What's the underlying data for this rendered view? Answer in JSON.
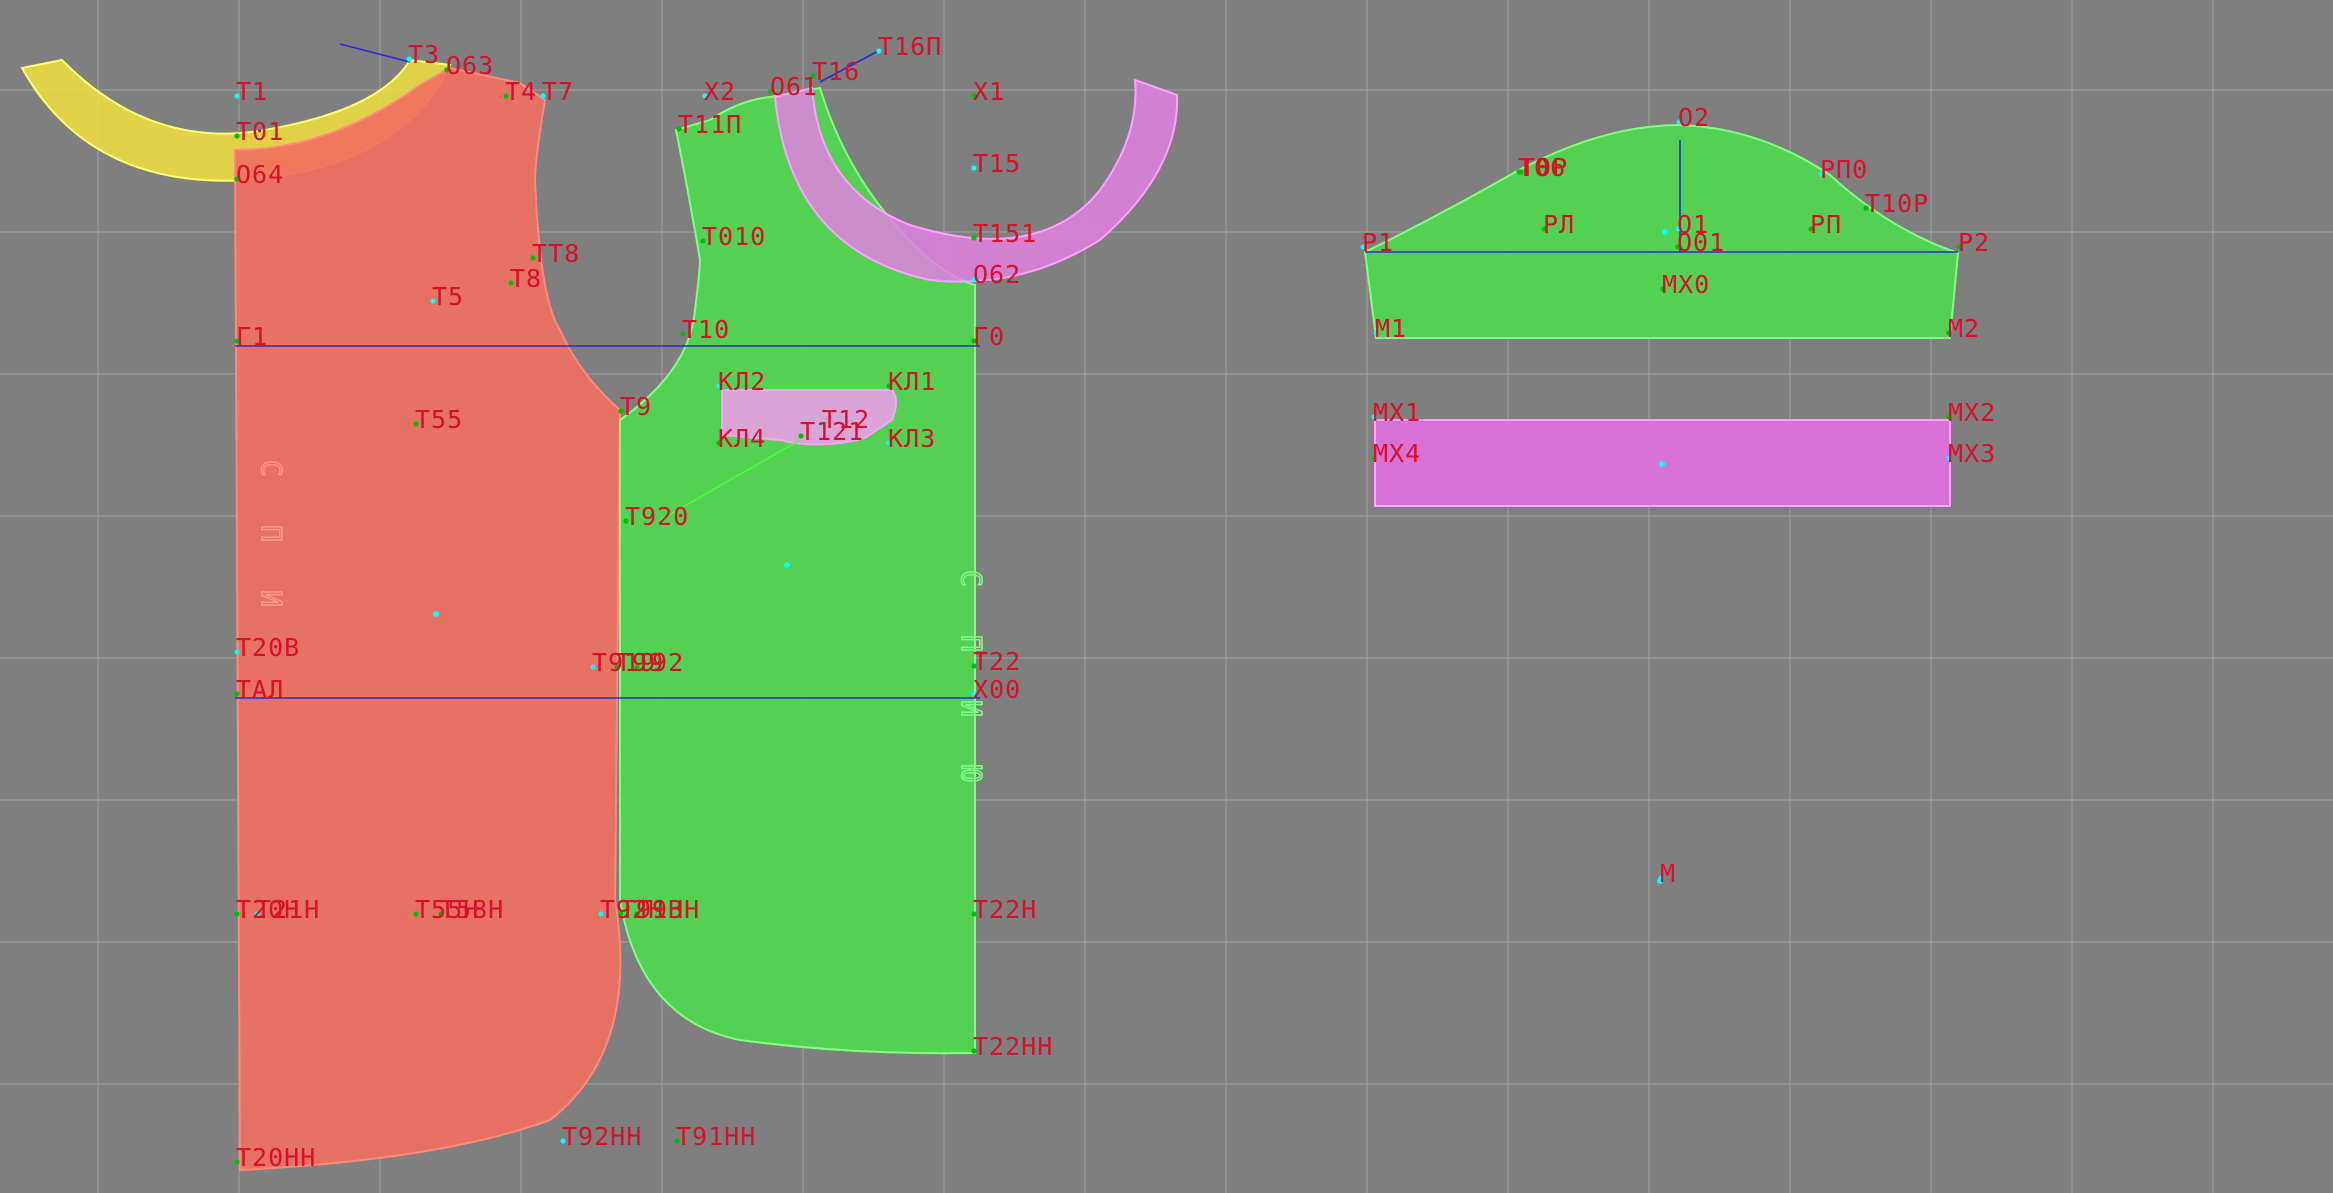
{
  "colors": {
    "background": "#7f7f7f",
    "grid": "#9a9a9a",
    "label": "#d8102a",
    "back_fill": "#f07060",
    "back_stroke": "#ff8a7a",
    "front_fill": "#4fd84f",
    "front_stroke": "#7fff7f",
    "facing_fill": "#f0e040",
    "facing_stroke": "#ffff70",
    "neck_facing_fill": "#e080e0",
    "neck_facing_stroke": "#ff9fff",
    "pocket_fill": "#e8a0e8",
    "sleeve_fill": "#4fd84f",
    "strip_fill": "#e070e0",
    "construction_line": "#2a2ad8",
    "point": "#00c000",
    "point_alt": "#00ffff"
  },
  "pieces": [
    {
      "id": "back",
      "name": "back-piece"
    },
    {
      "id": "front",
      "name": "front-piece"
    },
    {
      "id": "back_neck_facing",
      "name": "back-neck-facing"
    },
    {
      "id": "front_neck_facing",
      "name": "front-neck-facing"
    },
    {
      "id": "pocket",
      "name": "pocket-piece"
    },
    {
      "id": "sleeve",
      "name": "sleeve-piece"
    },
    {
      "id": "strip",
      "name": "cuff-strip"
    }
  ],
  "labels": {
    "back": [
      "Т1",
      "Т01",
      "О64",
      "Т3",
      "О63",
      "Т4",
      "Т7",
      "Т8",
      "ТТ8",
      "Т5",
      "Г1",
      "Т55",
      "Т20В",
      "ТАЛ",
      "Т20Н",
      "Т21Н",
      "Т55Н",
      "Т58Н",
      "Т92Н",
      "Т91Н",
      "Т93Н",
      "Т92НН",
      "Т91НН",
      "Т20НН",
      "Т919",
      "Т99",
      "Т92"
    ],
    "front": [
      "Х2",
      "О61",
      "Т16",
      "Т16П",
      "Х1",
      "Т11П",
      "Т15",
      "Т010",
      "Т151",
      "О62",
      "Т10",
      "Г0",
      "КЛ2",
      "КЛ1",
      "Т9",
      "Т12",
      "КЛ4",
      "Т121",
      "КЛ3",
      "Т920",
      "Т22",
      "Х00",
      "Т22Н",
      "Т22НН"
    ],
    "sleeve": [
      "О2",
      "Т06",
      "Т0Р",
      "РП0",
      "Т10Р",
      "РЛ",
      "О1",
      "О01",
      "РП",
      "Р1",
      "Р2",
      "МХ0",
      "М1",
      "М2"
    ],
    "strip": [
      "МХ1",
      "МХ2",
      "МХ4",
      "МХ3"
    ],
    "misc": [
      "М"
    ]
  }
}
